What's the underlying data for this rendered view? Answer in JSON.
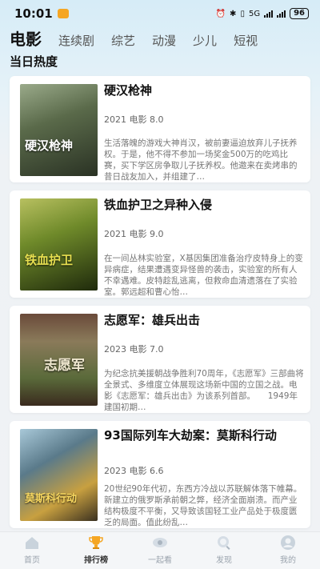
{
  "status_bar": {
    "time": "10:01",
    "battery": "96",
    "network": "5G"
  },
  "tabs": [
    {
      "label": "电影",
      "active": true
    },
    {
      "label": "连续剧"
    },
    {
      "label": "综艺"
    },
    {
      "label": "动漫"
    },
    {
      "label": "少儿"
    },
    {
      "label": "短视"
    }
  ],
  "section_title": "当日热度",
  "movies": [
    {
      "title": "硬汉枪神",
      "year": "2021",
      "category": "电影",
      "score": "8.0",
      "description": "生活落魄的游戏大神肖汉，被前妻逼迫放弃儿子抚养权。于是，他不得不参加一场奖金500万的吃鸡比赛，买下学区房争取儿子抚养权。他邀来在卖烤串的昔日战友加入，并组建了…",
      "poster_text": "硬汉枪神",
      "poster_colors": [
        "#7a8a6a",
        "#3b4a3a"
      ]
    },
    {
      "title": "铁血护卫之异种入侵",
      "year": "2021",
      "category": "电影",
      "score": "9.0",
      "description": "在一间丛林实验室，X基因集团准备治疗皮特身上的变异病症，结果遭遇变异怪兽的袭击，实验室的所有人不幸遇难。皮特趁乱逃离，但救命血清遗落在了实验室。郭远超和曹心怡…",
      "poster_text": "铁血护卫",
      "poster_colors": [
        "#6f8a2a",
        "#2f3a12"
      ]
    },
    {
      "title": "志愿军：雄兵出击",
      "year": "2023",
      "category": "电影",
      "score": "7.0",
      "description": "为纪念抗美援朝战争胜利70周年，《志愿军》三部曲将全景式、多维度立体展现这场新中国的立国之战。电影《志愿军：雄兵出击》为该系列首部。　　1949年建国初期…",
      "poster_text": "志愿军",
      "poster_colors": [
        "#8a6a4a",
        "#3a2a1e"
      ]
    },
    {
      "title": "93国际列车大劫案：莫斯科行动",
      "year": "2023",
      "category": "电影",
      "score": "6.6",
      "description": "20世纪90年代初，东西方冷战以苏联解体落下帷幕。新建立的俄罗斯承前朝之弊，经济全面崩溃。而产业结构极度不平衡，又导致该国轻工业产品处于极度匮乏的局面。值此纷乱…",
      "poster_text": "莫斯科行动",
      "poster_colors": [
        "#5a7a8a",
        "#c8a040"
      ]
    }
  ],
  "bottom_nav": [
    {
      "label": "首页",
      "icon": "home-icon"
    },
    {
      "label": "排行榜",
      "icon": "trophy-icon",
      "active": true
    },
    {
      "label": "一起看",
      "icon": "eye-icon"
    },
    {
      "label": "发现",
      "icon": "discover-icon"
    },
    {
      "label": "我的",
      "icon": "profile-icon"
    }
  ]
}
